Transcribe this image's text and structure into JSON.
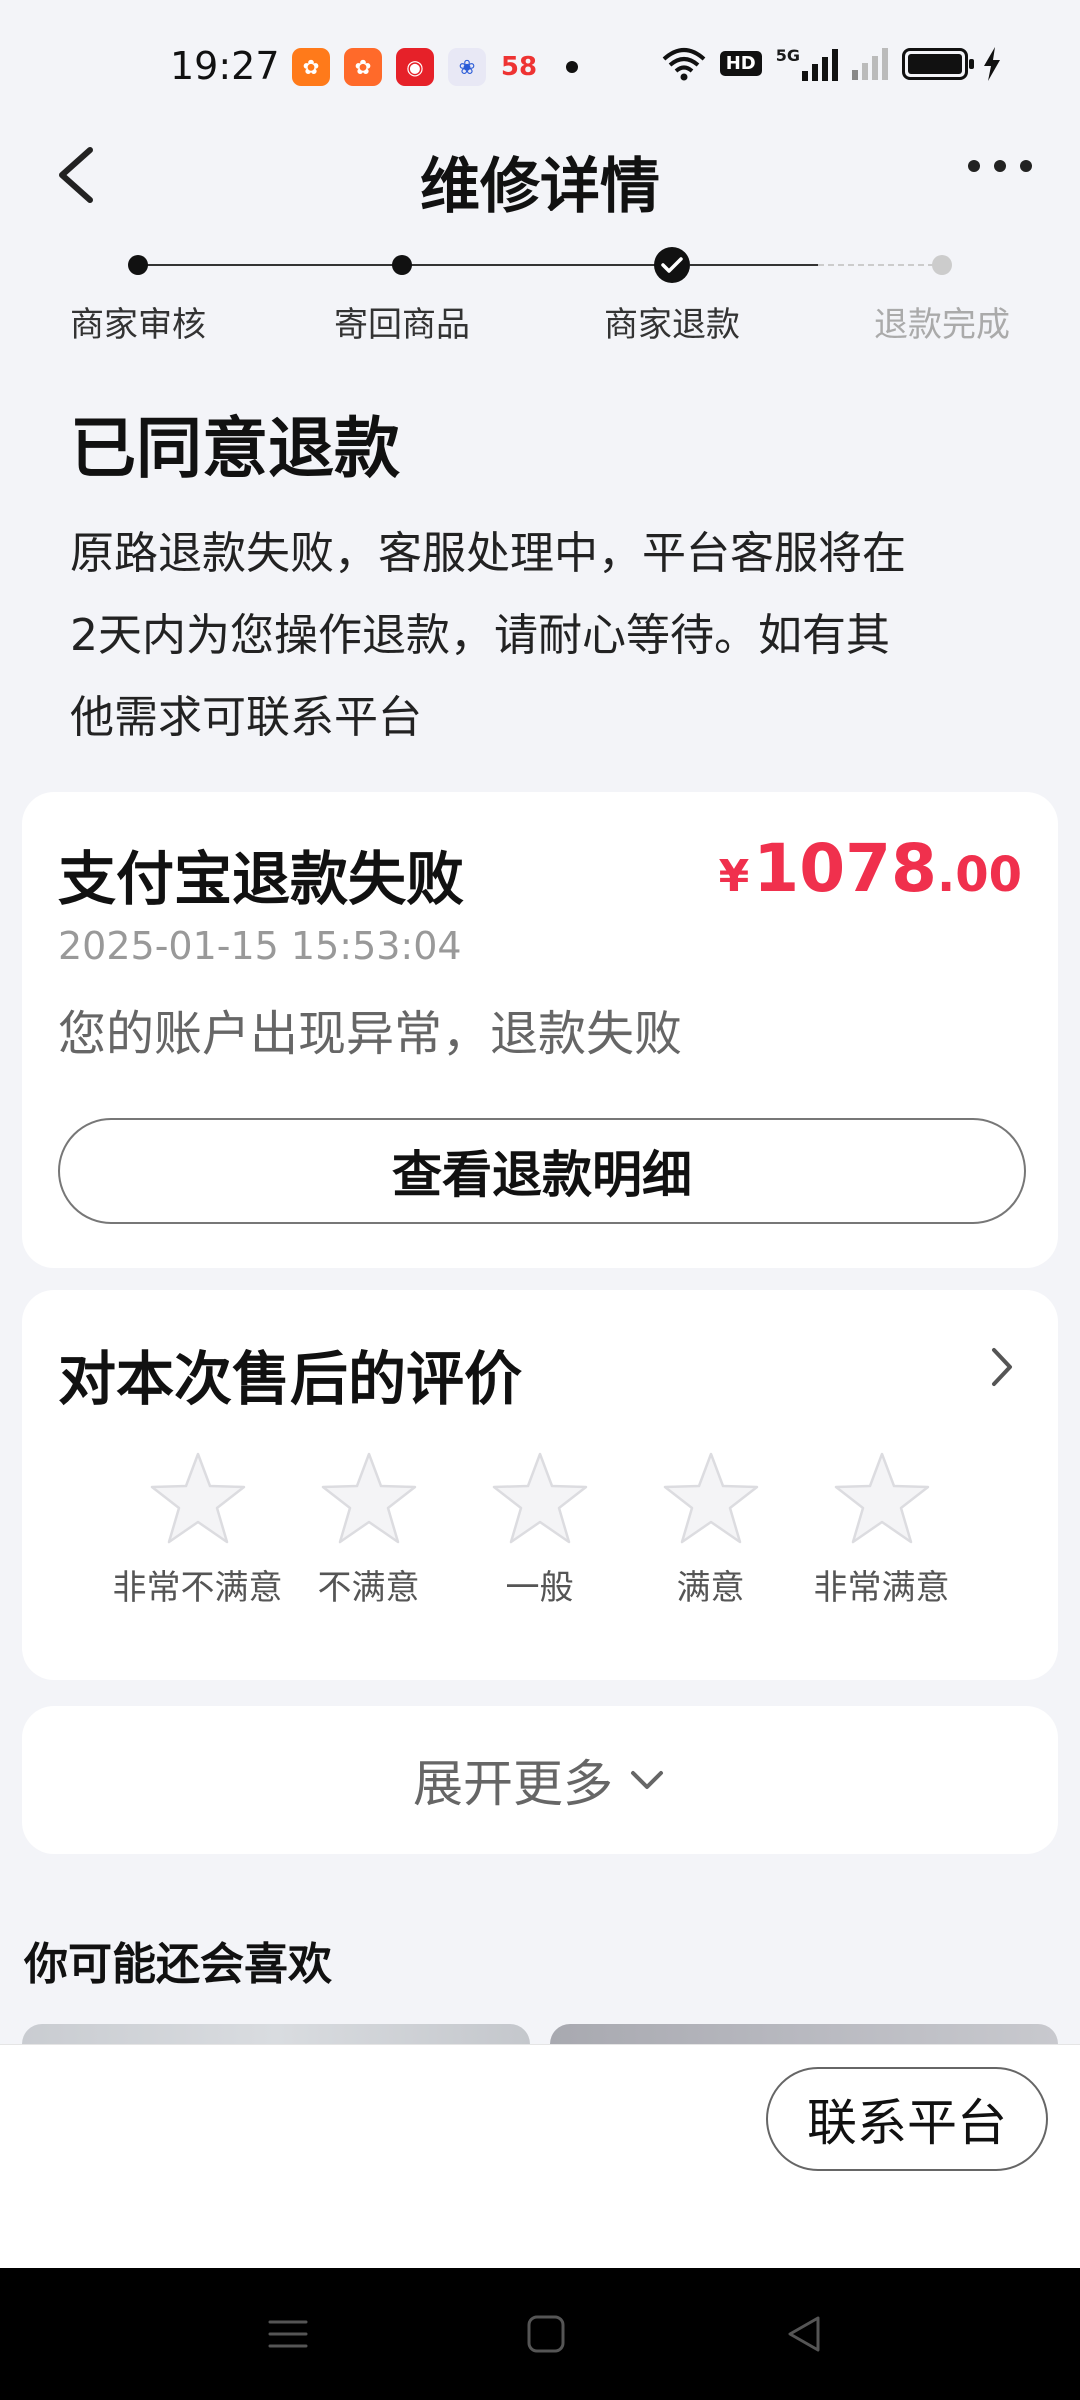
{
  "status_bar": {
    "time": "19:27",
    "apps": [
      {
        "icon": "kuaishou-lite-icon",
        "color": "#ff7a1a"
      },
      {
        "icon": "kuaishou-icon",
        "color": "#ff6a2a"
      },
      {
        "icon": "railway-icon",
        "color": "#e62129"
      },
      {
        "icon": "baidu-icon",
        "color": "#e8e8f5"
      },
      {
        "icon": "58-icon",
        "text": "58"
      }
    ],
    "hd_label": "HD",
    "network_label": "5G"
  },
  "header": {
    "title": "维修详情"
  },
  "progress": {
    "steps": [
      {
        "label": "商家审核",
        "state": "done"
      },
      {
        "label": "寄回商品",
        "state": "done"
      },
      {
        "label": "商家退款",
        "state": "current"
      },
      {
        "label": "退款完成",
        "state": "pending"
      }
    ]
  },
  "status": {
    "title": "已同意退款",
    "lines": [
      "原路退款失败，客服处理中，平台客服将在",
      "2天内为您操作退款，请耐心等待。如有其",
      "他需求可联系平台"
    ]
  },
  "refund_card": {
    "title": "支付宝退款失败",
    "currency": "¥",
    "amount_int": "1078",
    "amount_dec": ".00",
    "time": "2025-01-15 15:53:04",
    "reason": "您的账户出现异常，退款失败",
    "detail_button": "查看退款明细"
  },
  "rating_card": {
    "title": "对本次售后的评价",
    "options": [
      "非常不满意",
      "不满意",
      "一般",
      "满意",
      "非常满意"
    ]
  },
  "expand": {
    "label": "展开更多"
  },
  "recommend": {
    "title": "你可能还会喜欢"
  },
  "bottom_bar": {
    "contact_button": "联系平台"
  },
  "colors": {
    "accent_red": "#f0304d",
    "background": "#f3f4f8"
  }
}
